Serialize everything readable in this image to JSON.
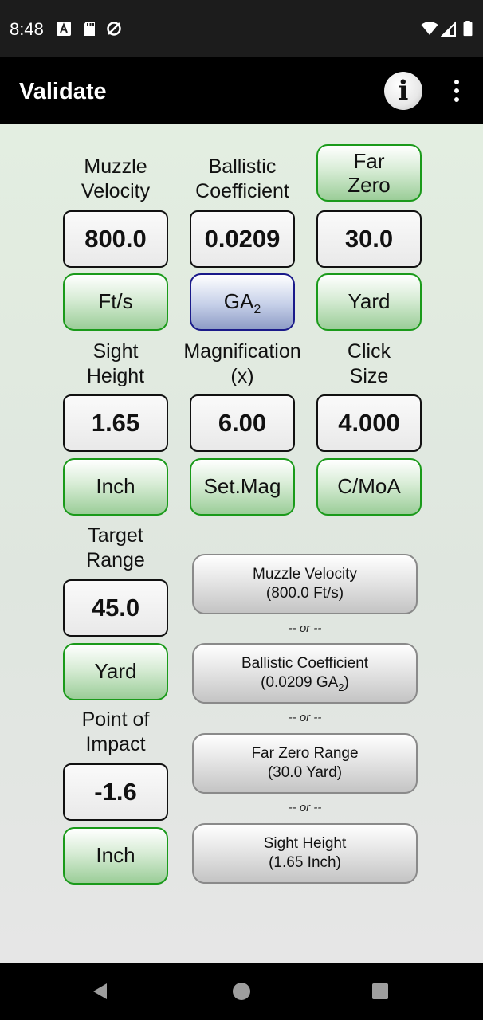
{
  "status_bar": {
    "time": "8:48",
    "left_icons": [
      "a-notification-icon",
      "sd-card-icon",
      "sync-disabled-icon"
    ],
    "right_icons": [
      "wifi-icon",
      "signal-icon",
      "battery-icon"
    ]
  },
  "app_bar": {
    "title": "Validate",
    "info_icon_glyph": "i"
  },
  "inputs": {
    "muzzle_velocity": {
      "label_line1": "Muzzle",
      "label_line2": "Velocity",
      "value": "800.0",
      "unit": "Ft/s"
    },
    "ballistic_coefficient": {
      "label_line1": "Ballistic",
      "label_line2": "Coefficient",
      "value": "0.0209",
      "unit_main": "GA",
      "unit_sub": "2"
    },
    "far_zero": {
      "button_line1": "Far",
      "button_line2": "Zero",
      "value": "30.0",
      "unit": "Yard"
    },
    "sight_height": {
      "label_line1": "Sight",
      "label_line2": "Height",
      "value": "1.65",
      "unit": "Inch"
    },
    "magnification": {
      "label_line1": "Magnification",
      "label_line2": "(x)",
      "value": "6.00",
      "unit": "Set.Mag"
    },
    "click_size": {
      "label_line1": "Click",
      "label_line2": "Size",
      "value": "4.000",
      "unit": "C/MoA"
    },
    "target_range": {
      "label_line1": "Target",
      "label_line2": "Range",
      "value": "45.0",
      "unit": "Yard"
    },
    "point_of_impact": {
      "label_line1": "Point of",
      "label_line2": "Impact",
      "value": "-1.6",
      "unit": "Inch"
    }
  },
  "solve_options": {
    "muzzle_velocity": {
      "line1": "Muzzle Velocity",
      "line2": "(800.0 Ft/s)"
    },
    "ballistic_coefficient": {
      "line1": "Ballistic Coefficient",
      "line2_pre": "(0.0209 GA",
      "line2_sub": "2",
      "line2_post": ")"
    },
    "far_zero_range": {
      "line1": "Far Zero Range",
      "line2": "(30.0 Yard)"
    },
    "sight_height": {
      "line1": "Sight Height",
      "line2": "(1.65 Inch)"
    },
    "separator": "-- or --"
  },
  "colors": {
    "green_accent": "#1a9a1a",
    "blue_accent": "#1a1a8a",
    "background": "#e3eee1"
  }
}
